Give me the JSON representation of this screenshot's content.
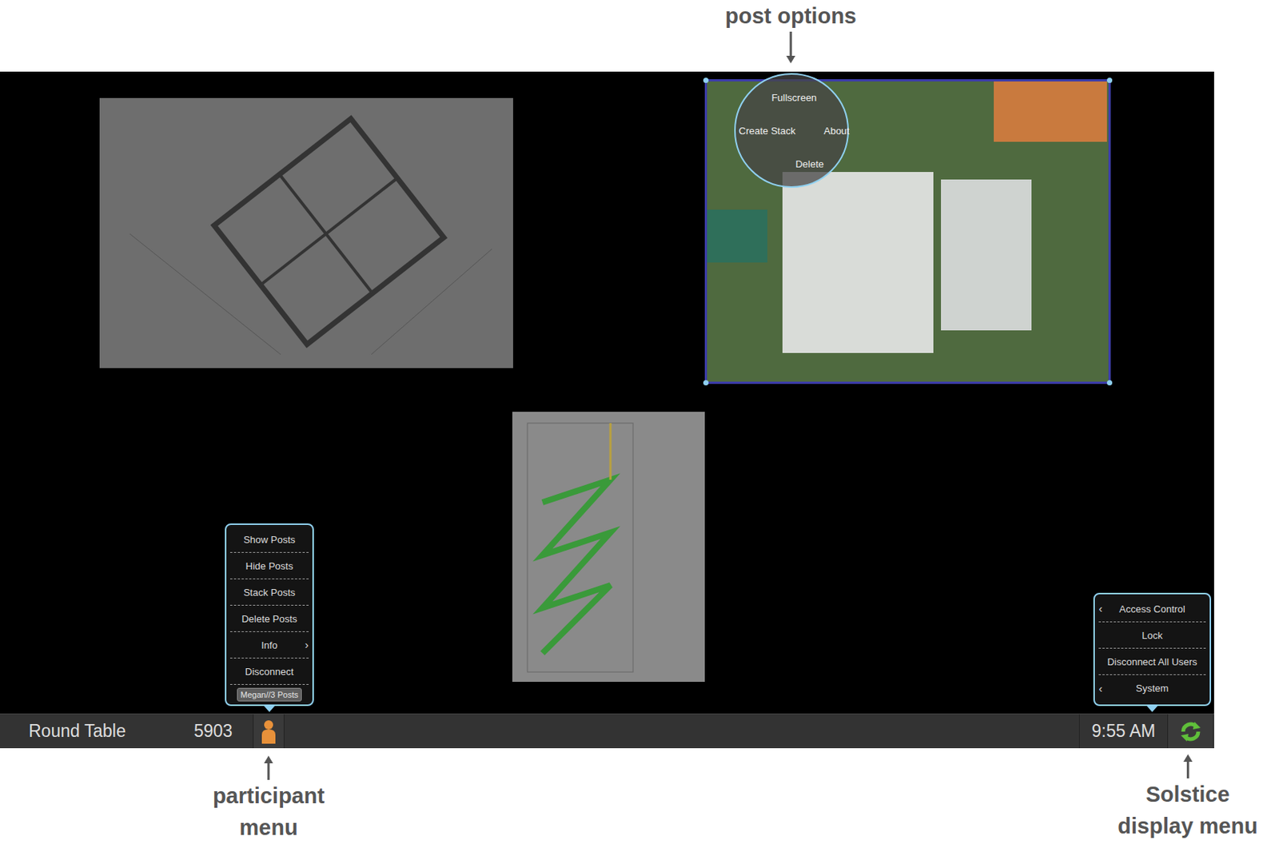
{
  "annotations": {
    "post_options": [
      "post options"
    ],
    "participant_menu": [
      "participant",
      "menu"
    ],
    "display_menu": [
      "Solstice",
      "display menu"
    ]
  },
  "status_bar": {
    "room": "Round Table",
    "key": "5903",
    "time": "9:55 AM"
  },
  "posts": [
    {
      "kind": "plan",
      "selected": false
    },
    {
      "kind": "aerial",
      "selected": true
    },
    {
      "kind": "stair",
      "selected": false
    }
  ],
  "post_options": {
    "open": true,
    "items": [
      "Fullscreen",
      "Create Stack",
      "About",
      "Delete"
    ]
  },
  "participant_menu": {
    "open": true,
    "items": [
      {
        "label": "Show Posts",
        "arrow": ""
      },
      {
        "label": "Hide Posts",
        "arrow": ""
      },
      {
        "label": "Stack Posts",
        "arrow": ""
      },
      {
        "label": "Delete Posts",
        "arrow": ""
      },
      {
        "label": "Info",
        "arrow": "›"
      },
      {
        "label": "Disconnect",
        "arrow": ""
      }
    ],
    "badge": "Megan//3 Posts"
  },
  "display_menu": {
    "open": true,
    "items": [
      {
        "label": "Access Control",
        "arrow": "‹"
      },
      {
        "label": "Lock",
        "arrow": ""
      },
      {
        "label": "Disconnect All Users",
        "arrow": ""
      },
      {
        "label": "System",
        "arrow": "‹"
      }
    ]
  }
}
